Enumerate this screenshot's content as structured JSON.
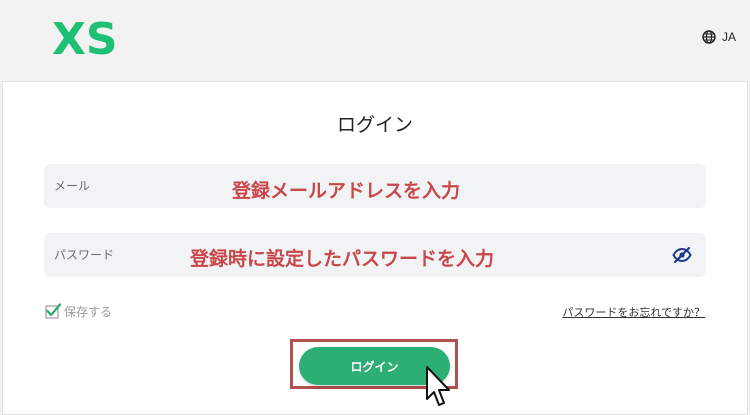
{
  "header": {
    "logo_text": "XS",
    "logo_color": "#1fbf76",
    "lang_icon": "globe-icon",
    "lang_label": "JA"
  },
  "form": {
    "title": "ログイン",
    "email": {
      "placeholder": "メール",
      "annotation": "登録メールアドレスを入力"
    },
    "password": {
      "placeholder": "パスワード",
      "annotation": "登録時に設定したパスワードを入力",
      "toggle_icon": "eye-slash-icon"
    },
    "remember": {
      "label": "保存する",
      "checked": true
    },
    "forgot_link": "パスワードをお忘れですか？",
    "login_button": "ログイン"
  },
  "colors": {
    "accent": "#2dae74",
    "annotation": "#c9474b",
    "highlight_border": "#b0504f",
    "eye_icon": "#1f3a8a"
  }
}
